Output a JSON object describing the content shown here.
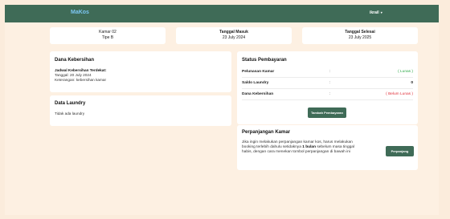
{
  "navbar": {
    "brand": "MaKos",
    "user": "ikrail"
  },
  "info_cards": [
    {
      "line1": "Kamar 02",
      "line2": "Tipe B"
    },
    {
      "line1": "Tanggal Masuk",
      "line2": "23 July 2024"
    },
    {
      "line1": "Tanggal Selesai",
      "line2": "23 July 2025"
    }
  ],
  "dana_kebersihan": {
    "title": "Dana Kebersihan",
    "subtitle": "Jadwal Kebersihan Terdekat:",
    "date": "Tanggal: 20 July 2024",
    "note": "Keterangan: kebersihan kamar"
  },
  "data_laundry": {
    "title": "Data Laundry",
    "empty": "Tidak ada laundry"
  },
  "status_pembayaran": {
    "title": "Status Pembayaran",
    "rows": [
      {
        "label": "Pelunasan Kamar",
        "sep": ":",
        "value": "( Lunas )",
        "color": "#2faa4a"
      },
      {
        "label": "Saldo Laundry",
        "sep": ":",
        "value": "0",
        "color": "#111111"
      },
      {
        "label": "Dana Kebersihan",
        "sep": ":",
        "value": "( Belum Lunas )",
        "color": "#e0303a"
      }
    ],
    "button": "Tambah Pembayaran"
  },
  "perpanjangan": {
    "title": "Perpanjangan Kamar",
    "text_1": "Jika ingin melakukan perpanjangan kamar kos, harus melakukan",
    "text_2a": "booking terlebih dahulu setidaknya ",
    "text_2b": "1 bulan",
    "text_2c": " sebelum masa tinggal",
    "text_3": "habis, dengan cara menekan tombol perpanjangan di bawah ini",
    "button": "Perpanjang"
  }
}
